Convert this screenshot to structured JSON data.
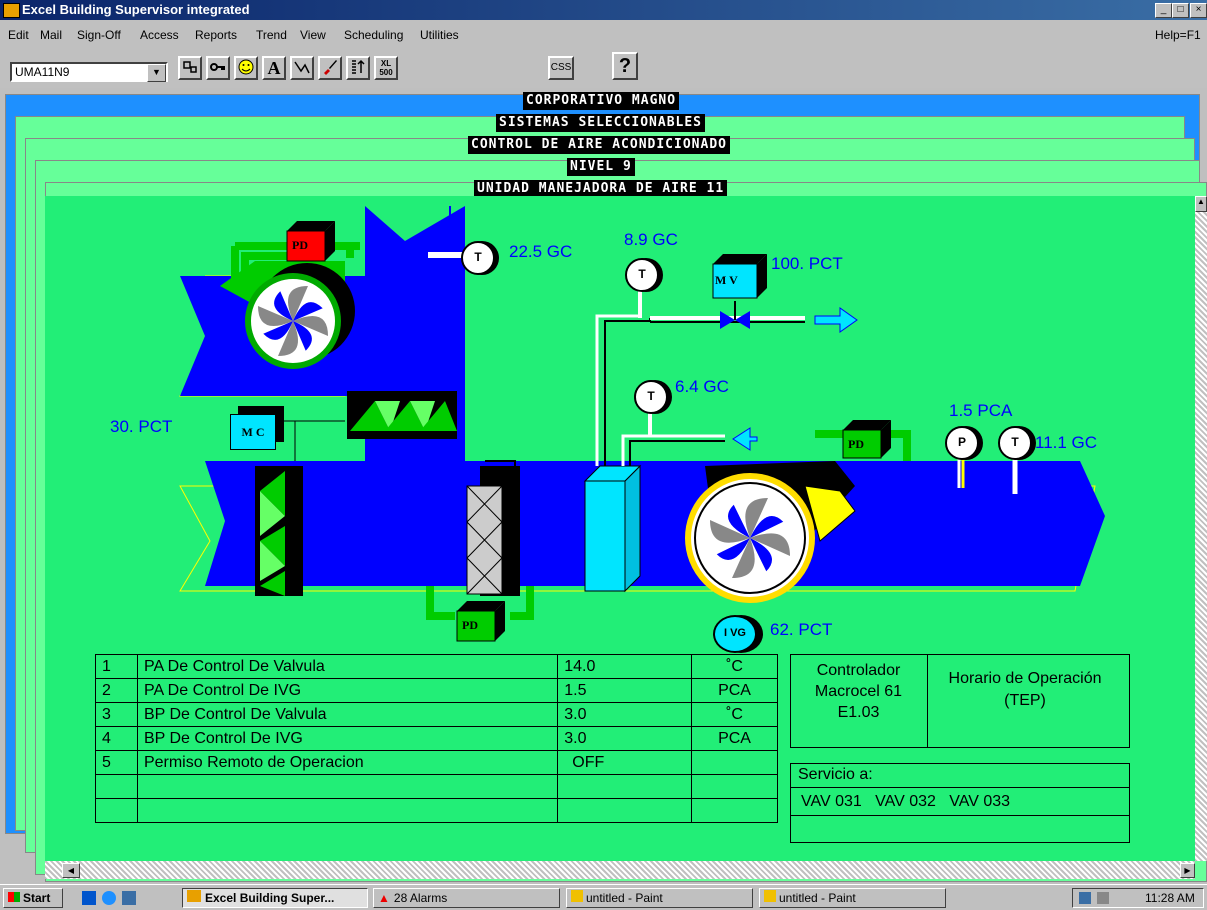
{
  "window": {
    "title": "Excel Building Supervisor integrated",
    "help": "Help=F1"
  },
  "menu": [
    "Edit",
    "Mail",
    "Sign-Off",
    "Access",
    "Reports",
    "Trend",
    "View",
    "Scheduling",
    "Utilities"
  ],
  "toolbar": {
    "combo_value": "UMA11N9",
    "css_label": "CSS",
    "help_label": "?",
    "xl_top": "XL",
    "xl_bottom": "500",
    "a_label": "A"
  },
  "mdi_titles": [
    "CORPORATIVO MAGNO",
    "SISTEMAS SELECCIONABLES",
    "CONTROL DE AIRE ACONDICIONADO",
    "NIVEL 9",
    "UNIDAD MANEJADORA DE AIRE 11"
  ],
  "diagram": {
    "temp1": "22.5 GC",
    "temp2": "8.9 GC",
    "valve_pos": "100. PCT",
    "temp3": "6.4 GC",
    "pressure": "1.5 PCA",
    "temp4": "11.1 GC",
    "damper_pos": "30. PCT",
    "ivg_pos": "62. PCT",
    "sensor_t": "T",
    "sensor_p": "P",
    "pd": "PD",
    "mv": "M V",
    "mc": "M C",
    "ivg": "I VG"
  },
  "params": [
    {
      "n": "1",
      "label": "PA De Control De Valvula",
      "value": "14.0",
      "unit": "˚C"
    },
    {
      "n": "2",
      "label": "PA De Control De IVG",
      "value": "1.5",
      "unit": "PCA"
    },
    {
      "n": "3",
      "label": "BP De Control De Valvula",
      "value": "3.0",
      "unit": "˚C"
    },
    {
      "n": "4",
      "label": "BP De Control De IVG",
      "value": "3.0",
      "unit": "PCA"
    },
    {
      "n": "5",
      "label": "Permiso Remoto de Operacion",
      "value": "OFF",
      "unit": ""
    }
  ],
  "controller": {
    "line1": "Controlador",
    "line2": "Macrocel 61",
    "line3": "E1.03",
    "schedule": "Horario de Operación (TEP)"
  },
  "service": {
    "label": "Servicio a:",
    "items": "VAV 031   VAV 032   VAV 033"
  },
  "taskbar": {
    "start": "Start",
    "app": "Excel Building Super...",
    "alarms": "28 Alarms",
    "paint1": "untitled - Paint",
    "paint2": "untitled - Paint",
    "clock": "11:28 AM"
  }
}
